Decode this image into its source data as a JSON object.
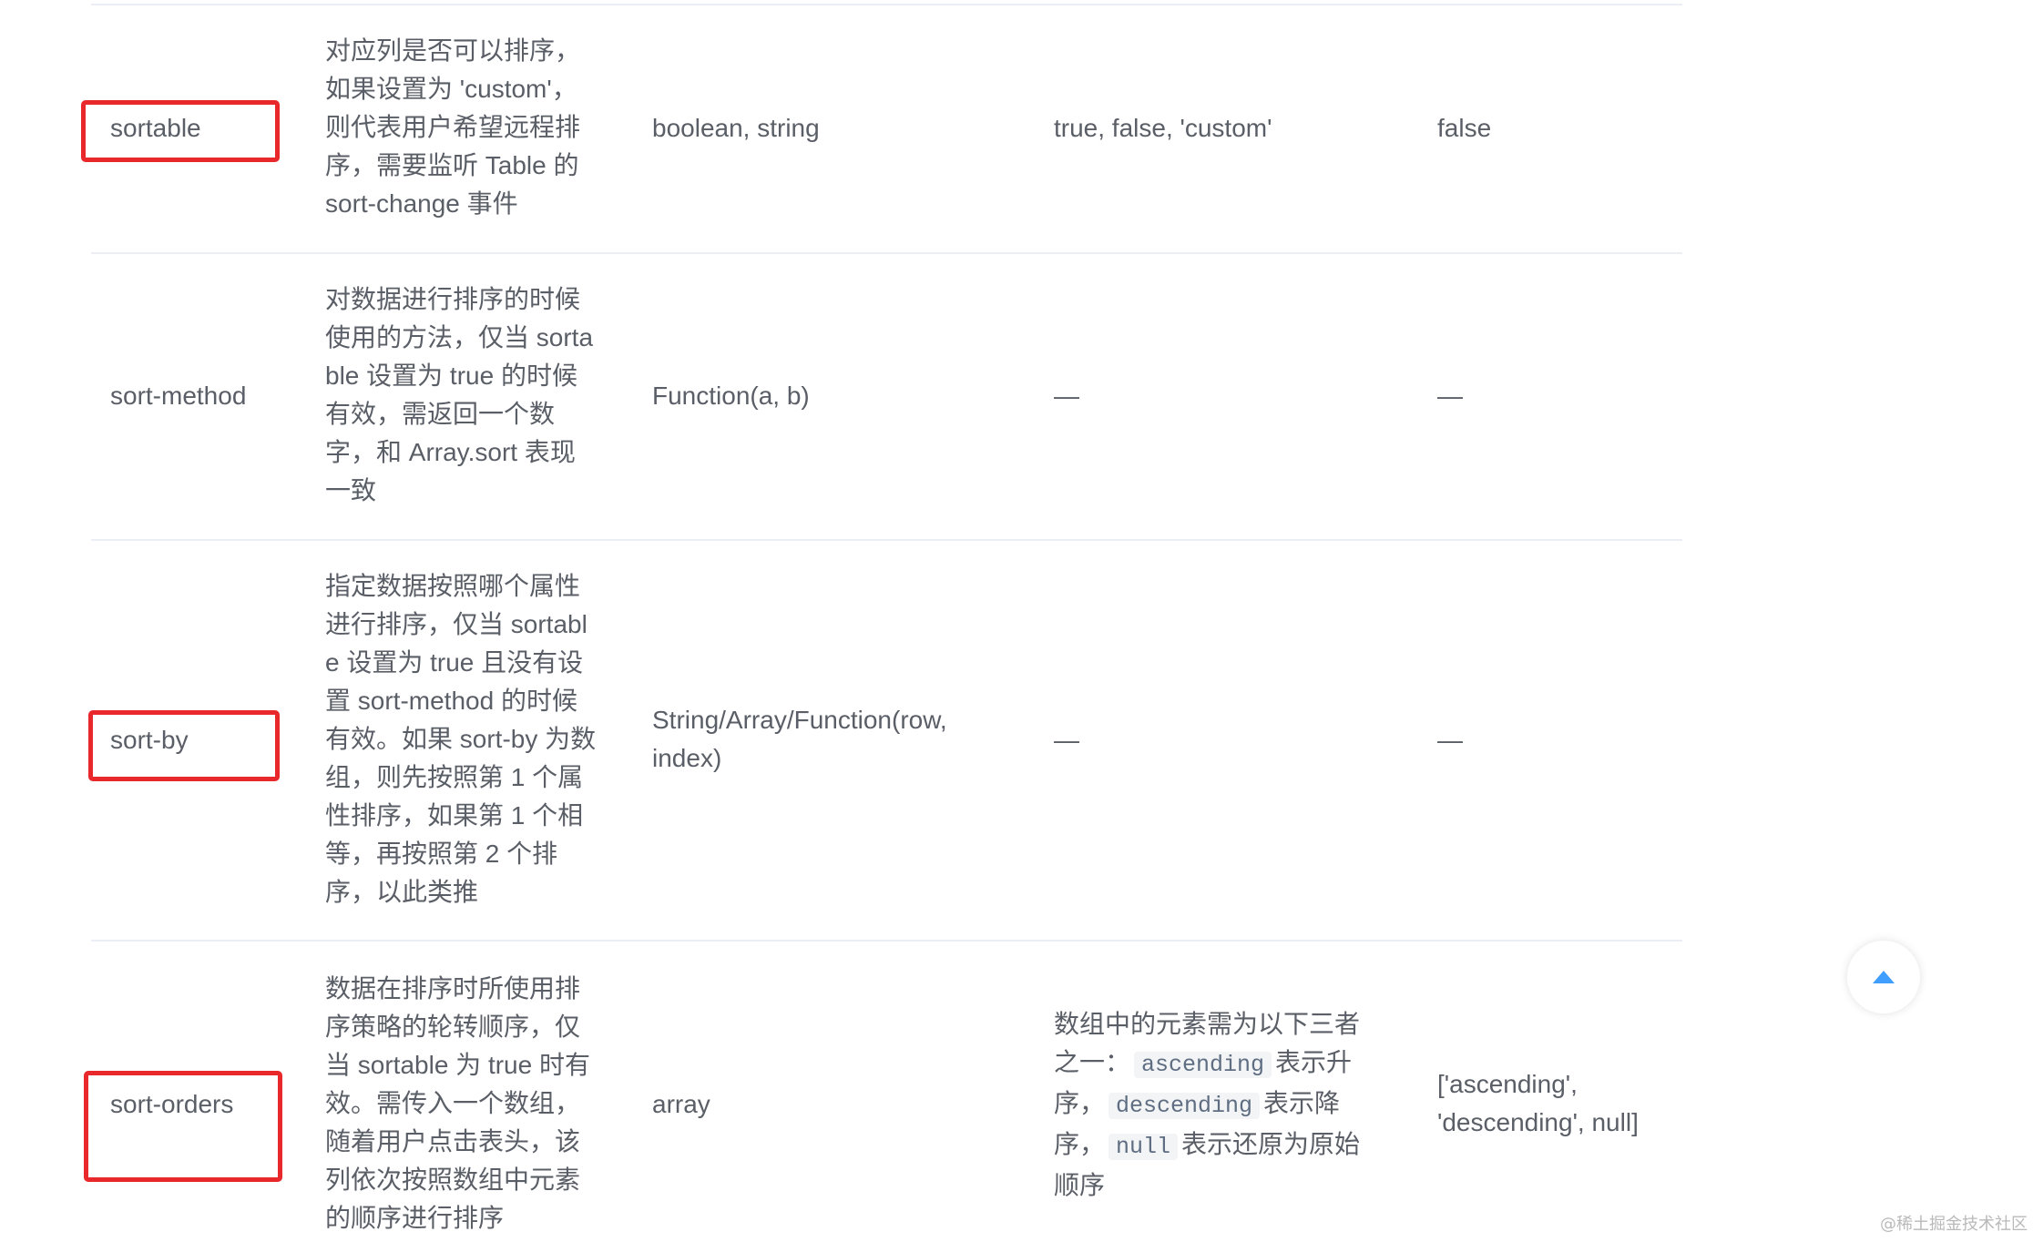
{
  "table": {
    "rows": [
      {
        "param": "sortable",
        "description": "对应列是否可以排序，如果设置为 'custom'，则代表用户希望远程排序，需要监听 Table 的 sort-change 事件",
        "type": "boolean, string",
        "accepted_values": "true, false, 'custom'",
        "default": "false",
        "highlighted": true
      },
      {
        "param": "sort-method",
        "description": "对数据进行排序的时候使用的方法，仅当 sortable 设置为 true 的时候有效，需返回一个数字，和 Array.sort 表现一致",
        "type": "Function(a, b)",
        "accepted_values": "—",
        "default": "—",
        "highlighted": false
      },
      {
        "param": "sort-by",
        "description": "指定数据按照哪个属性进行排序，仅当 sortable 设置为 true 且没有设置 sort-method 的时候有效。如果 sort-by 为数组，则先按照第 1 个属性排序，如果第 1 个相等，再按照第 2 个排序，以此类推",
        "type": "String/Array/Function(row, index)",
        "accepted_values": "—",
        "default": "—",
        "highlighted": true
      },
      {
        "param": "sort-orders",
        "description": "数据在排序时所使用排序策略的轮转顺序，仅当 sortable 为 true 时有效。需传入一个数组，随着用户点击表头，该列依次按照数组中元素的顺序进行排序",
        "type": "array",
        "accepted_values_parts": {
          "intro": "数组中的元素需为以下三者之一：",
          "code1": "ascending",
          "text1": "表示升序，",
          "code2": "descending",
          "text2": "表示降序，",
          "code3": "null",
          "text3": "表示还原为原始顺序"
        },
        "default": "['ascending', 'descending', null]",
        "highlighted": true
      }
    ]
  },
  "back_to_top": {
    "icon": "caret-up-icon",
    "color": "#409eff"
  },
  "watermark": "@稀土掘金技术社区",
  "colors": {
    "highlight": "#e8282b",
    "border": "#ebeef5",
    "text": "#5a5e66"
  }
}
